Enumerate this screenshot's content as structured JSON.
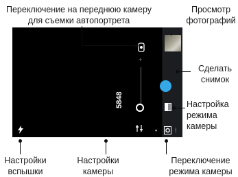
{
  "labels": {
    "front_camera": [
      "Переключение на переднюю камеру",
      "для съемки автопортрета"
    ],
    "view_photos": [
      "Просмотр",
      "фотографий"
    ],
    "take_photo": [
      "Сделать",
      "снимок"
    ],
    "mode_settings": [
      "Настройка",
      "режима",
      "камеры"
    ],
    "flash_settings": [
      "Настройки",
      "вспышки"
    ],
    "camera_settings": [
      "Настройки",
      "камеры"
    ],
    "switch_mode": [
      "Переключение",
      "режима камеры"
    ]
  },
  "viewfinder": {
    "shots_remaining": "5848",
    "plus_glyph": "+"
  },
  "colors": {
    "shutter": "#35a9e8",
    "screen": "#000000",
    "panel": "#1b1d21"
  },
  "icons": {
    "front_camera": "front-camera-switch-icon",
    "flash": "flash-icon",
    "settings": "camera-settings-icon",
    "mode": "camera-mode-icon",
    "shutter": "shutter-button"
  }
}
